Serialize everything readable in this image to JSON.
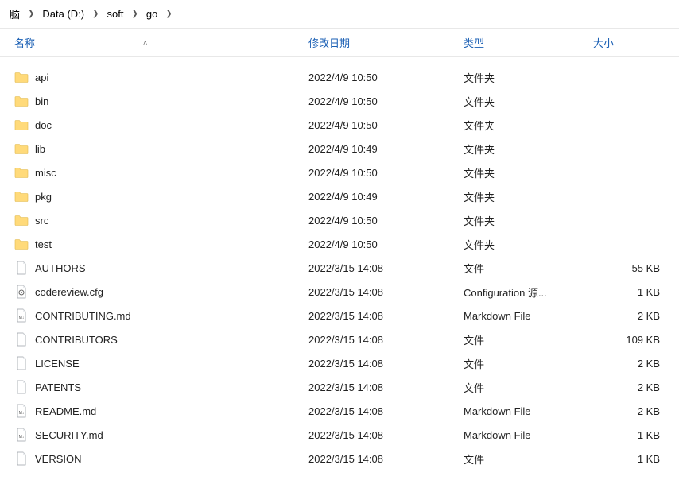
{
  "breadcrumb": {
    "items": [
      {
        "label": "脑"
      },
      {
        "label": "Data (D:)"
      },
      {
        "label": "soft"
      },
      {
        "label": "go"
      }
    ]
  },
  "columns": {
    "name": "名称",
    "date": "修改日期",
    "type": "类型",
    "size": "大小"
  },
  "files": [
    {
      "name": "api",
      "date": "2022/4/9 10:50",
      "type": "文件夹",
      "size": "",
      "icon": "folder"
    },
    {
      "name": "bin",
      "date": "2022/4/9 10:50",
      "type": "文件夹",
      "size": "",
      "icon": "folder"
    },
    {
      "name": "doc",
      "date": "2022/4/9 10:50",
      "type": "文件夹",
      "size": "",
      "icon": "folder"
    },
    {
      "name": "lib",
      "date": "2022/4/9 10:49",
      "type": "文件夹",
      "size": "",
      "icon": "folder"
    },
    {
      "name": "misc",
      "date": "2022/4/9 10:50",
      "type": "文件夹",
      "size": "",
      "icon": "folder"
    },
    {
      "name": "pkg",
      "date": "2022/4/9 10:49",
      "type": "文件夹",
      "size": "",
      "icon": "folder"
    },
    {
      "name": "src",
      "date": "2022/4/9 10:50",
      "type": "文件夹",
      "size": "",
      "icon": "folder"
    },
    {
      "name": "test",
      "date": "2022/4/9 10:50",
      "type": "文件夹",
      "size": "",
      "icon": "folder"
    },
    {
      "name": "AUTHORS",
      "date": "2022/3/15 14:08",
      "type": "文件",
      "size": "55 KB",
      "icon": "file"
    },
    {
      "name": "codereview.cfg",
      "date": "2022/3/15 14:08",
      "type": "Configuration 源...",
      "size": "1 KB",
      "icon": "cfg"
    },
    {
      "name": "CONTRIBUTING.md",
      "date": "2022/3/15 14:08",
      "type": "Markdown File",
      "size": "2 KB",
      "icon": "md"
    },
    {
      "name": "CONTRIBUTORS",
      "date": "2022/3/15 14:08",
      "type": "文件",
      "size": "109 KB",
      "icon": "file"
    },
    {
      "name": "LICENSE",
      "date": "2022/3/15 14:08",
      "type": "文件",
      "size": "2 KB",
      "icon": "file"
    },
    {
      "name": "PATENTS",
      "date": "2022/3/15 14:08",
      "type": "文件",
      "size": "2 KB",
      "icon": "file"
    },
    {
      "name": "README.md",
      "date": "2022/3/15 14:08",
      "type": "Markdown File",
      "size": "2 KB",
      "icon": "md"
    },
    {
      "name": "SECURITY.md",
      "date": "2022/3/15 14:08",
      "type": "Markdown File",
      "size": "1 KB",
      "icon": "md"
    },
    {
      "name": "VERSION",
      "date": "2022/3/15 14:08",
      "type": "文件",
      "size": "1 KB",
      "icon": "file"
    }
  ]
}
